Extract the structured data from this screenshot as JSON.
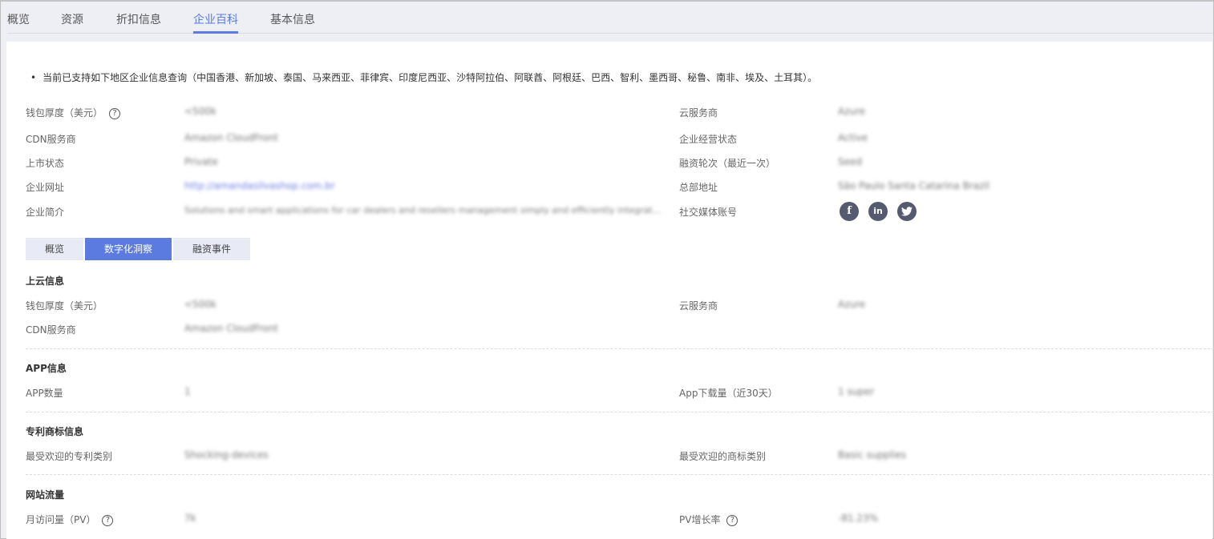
{
  "nav": {
    "tabs": [
      "概览",
      "资源",
      "折扣信息",
      "企业百科",
      "基本信息"
    ],
    "active": "企业百科"
  },
  "notice": "当前已支持如下地区企业信息查询（中国香港、新加坡、泰国、马来西亚、菲律宾、印度尼西亚、沙特阿拉伯、阿联酋、阿根廷、巴西、智利、墨西哥、秘鲁、南非、埃及、土耳其）。",
  "overview": {
    "left": [
      {
        "label": "钱包厚度（美元）",
        "value": "<500k",
        "help": "?"
      },
      {
        "label": "CDN服务商",
        "value": "Amazon CloudFront"
      },
      {
        "label": "上市状态",
        "value": "Private"
      },
      {
        "label": "企业网址",
        "value": "http://amandasilvashop.com.br"
      },
      {
        "label": "企业简介",
        "value": "Solutions and smart applications for car dealers and resellers management simply and efficiently integrat..."
      }
    ],
    "right": [
      {
        "label": "云服务商",
        "value": "Azure"
      },
      {
        "label": "企业经营状态",
        "value": "Active"
      },
      {
        "label": "融资轮次（最近一次）",
        "value": "Seed"
      },
      {
        "label": "总部地址",
        "value": "São Paulo Santa Catarina Brazil"
      },
      {
        "label": "社交媒体账号"
      }
    ],
    "social": [
      "f",
      "in",
      "t"
    ]
  },
  "subtabs": [
    "概览",
    "数字化洞察",
    "融资事件"
  ],
  "subtab_active": "数字化洞察",
  "sections": {
    "cloud": {
      "title": "上云信息",
      "wallet_label": "钱包厚度（美元）",
      "wallet": "<500k",
      "cloud_label": "云服务商",
      "cloud": "Azure",
      "cdn_label": "CDN服务商",
      "cdn": "Amazon CloudFront"
    },
    "app": {
      "title": "APP信息",
      "count_label": "APP数量",
      "count": "1",
      "dl_label": "App下载量（近30天）",
      "dl": "1 super"
    },
    "patent": {
      "title": "专利商标信息",
      "patent_label": "最受欢迎的专利类别",
      "patent": "Shocking-devices",
      "tm_label": "最受欢迎的商标类别",
      "tm": "Basic supplies"
    },
    "traffic": {
      "title": "网站流量",
      "pv_label": "月访问量（PV）",
      "pv": "7k",
      "growth_label": "PV增长率",
      "growth": "-81.23%",
      "help": "?"
    }
  }
}
